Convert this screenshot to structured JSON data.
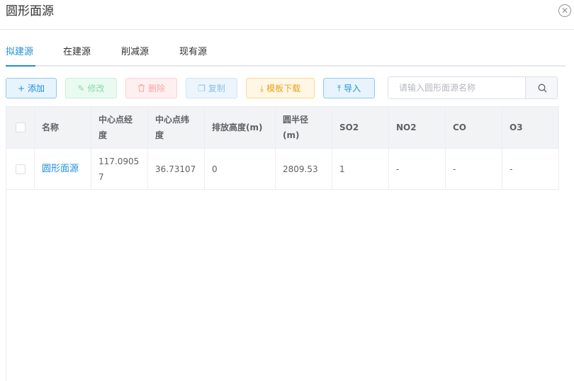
{
  "dialog": {
    "title": "圆形面源",
    "close_icon": "close-circle-icon"
  },
  "tabs": [
    {
      "label": "拟建源",
      "active": true
    },
    {
      "label": "在建源",
      "active": false
    },
    {
      "label": "削减源",
      "active": false
    },
    {
      "label": "现有源",
      "active": false
    }
  ],
  "toolbar": {
    "add": {
      "icon": "+",
      "label": "添加"
    },
    "edit": {
      "icon": "✎",
      "label": "修改"
    },
    "delete": {
      "icon": "🗑",
      "label": "删除"
    },
    "copy": {
      "icon": "❐",
      "label": "复制"
    },
    "template_download": {
      "icon": "⤓",
      "label": "模板下载"
    },
    "import": {
      "icon": "⤒",
      "label": "导入"
    }
  },
  "search": {
    "placeholder": "请输入圆形面源名称",
    "value": ""
  },
  "table": {
    "headers": [
      "名称",
      "中心点经度",
      "中心点纬度",
      "排放高度(m)",
      "圆半径(m)",
      "SO2",
      "NO2",
      "CO",
      "O3"
    ],
    "rows": [
      {
        "name": "圆形面源",
        "lon": "117.09057",
        "lat": "36.73107",
        "height": "0",
        "radius": "2809.53",
        "so2": "1",
        "no2": "-",
        "co": "-",
        "o3": "-"
      }
    ]
  },
  "colors": {
    "primary": "#1f8fdc",
    "header_bg": "#f2f3f5",
    "warning": "#e8a317"
  }
}
